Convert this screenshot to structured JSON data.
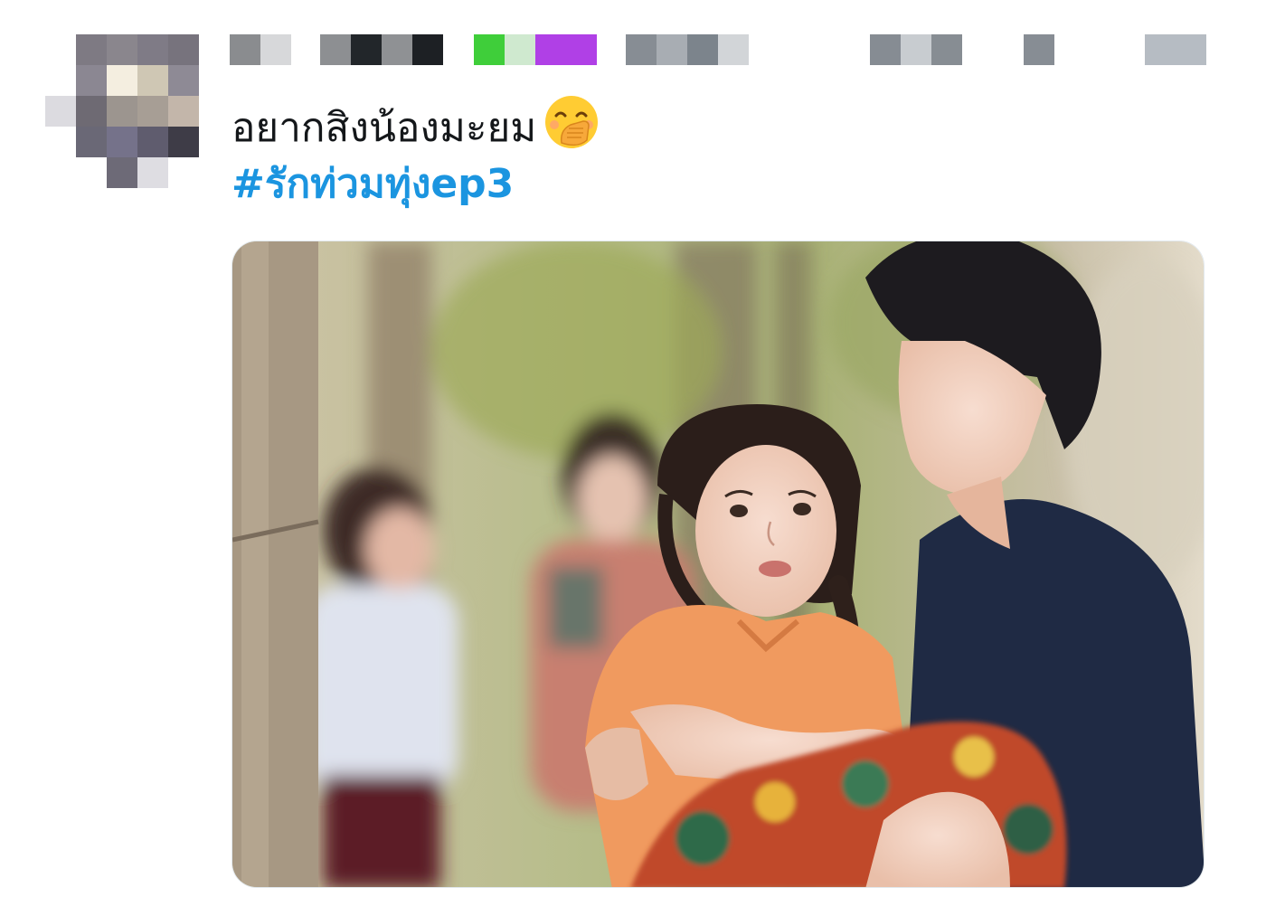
{
  "tweet": {
    "text": "อยากสิงน้องมะยม",
    "emoji": "face-with-hand-over-mouth-icon",
    "hashtag": "#รักท่วมทุ่งep3"
  },
  "colors": {
    "text": "#14171a",
    "hashtag": "#1b95e0",
    "media_border": "#e1e8ed"
  },
  "icons": {
    "avatar": "pixelated-avatar",
    "name": "pixelated-name-and-handle"
  }
}
